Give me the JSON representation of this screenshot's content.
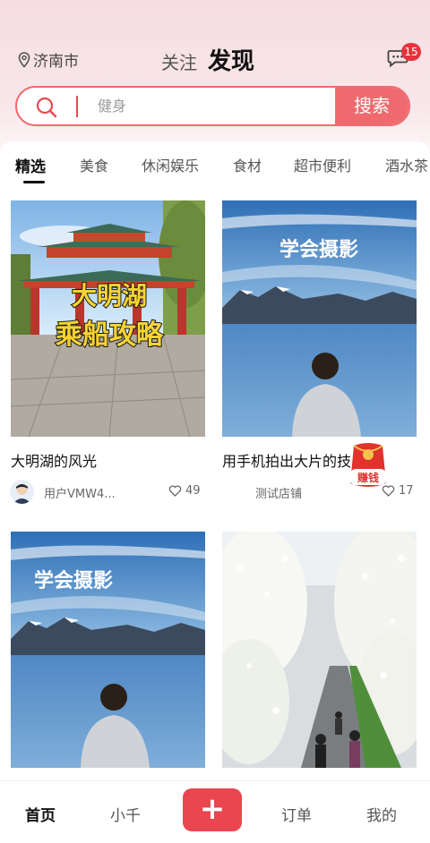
{
  "header": {
    "location": "济南市",
    "tab_follow": "关注",
    "tab_discover": "发现",
    "message_badge": "15"
  },
  "search": {
    "placeholder": "健身",
    "button_label": "搜索"
  },
  "categories": [
    {
      "label": "精选",
      "active": true
    },
    {
      "label": "美食"
    },
    {
      "label": "休闲娱乐"
    },
    {
      "label": "食材"
    },
    {
      "label": "超市便利"
    },
    {
      "label": "酒水茶"
    }
  ],
  "cards": [
    {
      "image_overlay_line1": "大明湖",
      "image_overlay_line2": "乘船攻略",
      "title": "大明湖的风光",
      "author": "用户VMW4...",
      "likes": "49"
    },
    {
      "image_overlay": "学会摄影",
      "title": "用手机拍出大片的技",
      "author": "测试店铺",
      "likes": "17"
    },
    {
      "image_overlay": "学会摄影"
    },
    {}
  ],
  "red_packet_label": "赚钱",
  "bottom_nav": {
    "home": "首页",
    "xiaoqian": "小千",
    "plus": "+",
    "orders": "订单",
    "mine": "我的"
  },
  "colors": {
    "accent": "#ef6a6e",
    "badge": "#e8323d",
    "plus_button": "#ea4650"
  }
}
